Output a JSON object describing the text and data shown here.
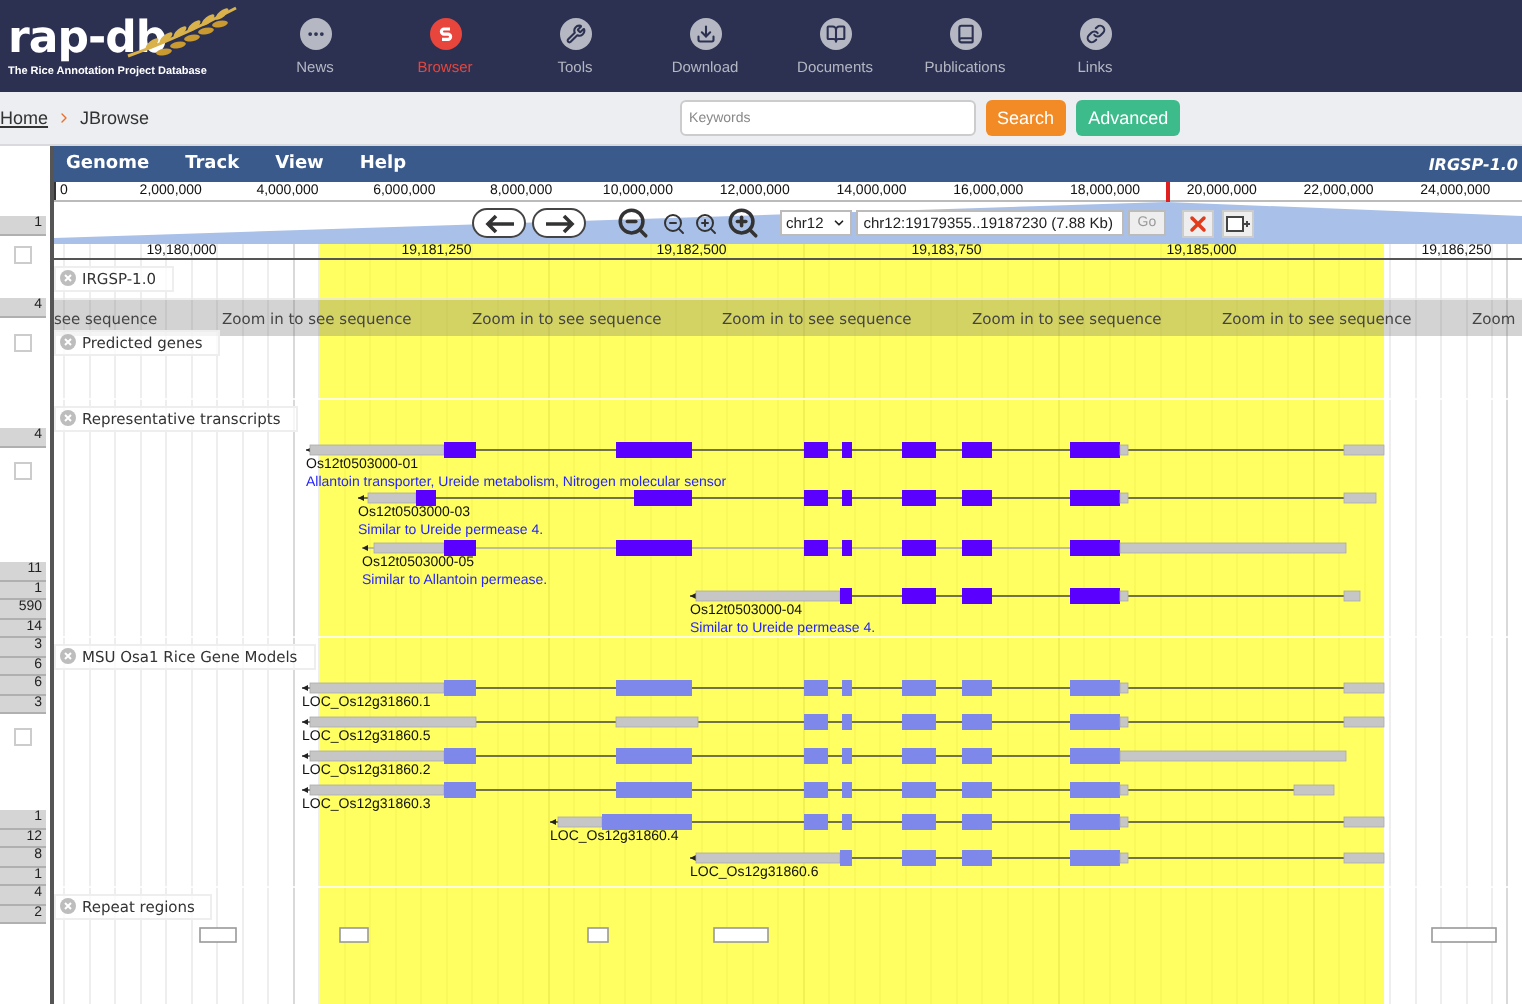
{
  "header": {
    "logo": "rap-db",
    "subtitle": "The Rice Annotation Project Database",
    "nav": [
      {
        "label": "News",
        "selected": false
      },
      {
        "label": "Browser",
        "selected": true
      },
      {
        "label": "Tools",
        "selected": false
      },
      {
        "label": "Download",
        "selected": false
      },
      {
        "label": "Documents",
        "selected": false
      },
      {
        "label": "Publications",
        "selected": false
      },
      {
        "label": "Links",
        "selected": false
      }
    ]
  },
  "breadcrumb": [
    "Home",
    "JBrowse"
  ],
  "search": {
    "placeholder": "Keywords",
    "buttons": [
      "Search",
      "Advanced"
    ]
  },
  "menu": [
    "Genome",
    "Track",
    "View",
    "Help"
  ],
  "assembly": "IRGSP-1.0",
  "overview_ruler": [
    "0",
    "2,000,000",
    "4,000,000",
    "6,000,000",
    "8,000,000",
    "10,000,000",
    "12,000,000",
    "14,000,000",
    "16,000,000",
    "18,000,000",
    "20,000,000",
    "22,000,000",
    "24,000,000"
  ],
  "navigation": {
    "chromosome": "chr12",
    "location": "chr12:19179355..19187230 (7.88 Kb)",
    "go": "Go"
  },
  "detail_ruler": [
    "19,180,000",
    "19,181,250",
    "19,182,500",
    "19,183,750",
    "19,185,000",
    "19,186,250"
  ],
  "gutter": [
    {
      "kind": "count",
      "text": "1"
    },
    {
      "kind": "checkbox",
      "checked": false
    },
    {
      "kind": "count",
      "text": "4"
    },
    {
      "kind": "checkbox",
      "checked": false
    },
    {
      "kind": "count",
      "text": "4"
    },
    {
      "kind": "checkbox",
      "checked": false
    },
    {
      "kind": "count",
      "text": "11"
    },
    {
      "kind": "count",
      "text": "1"
    },
    {
      "kind": "count",
      "text": "590"
    },
    {
      "kind": "count",
      "text": "14"
    },
    {
      "kind": "count",
      "text": "3"
    },
    {
      "kind": "count",
      "text": "6"
    },
    {
      "kind": "count",
      "text": "6"
    },
    {
      "kind": "count",
      "text": "3"
    },
    {
      "kind": "checkbox",
      "checked": false
    },
    {
      "kind": "count",
      "text": "1"
    },
    {
      "kind": "count",
      "text": "12"
    },
    {
      "kind": "count",
      "text": "8"
    },
    {
      "kind": "count",
      "text": "1"
    },
    {
      "kind": "count",
      "text": "4"
    },
    {
      "kind": "count",
      "text": "2"
    }
  ],
  "tracks": [
    {
      "kind": "sequence",
      "label": "IRGSP-1.0",
      "messages": [
        "see sequence",
        "Zoom in to see sequence",
        "Zoom in to see sequence",
        "Zoom in to see sequence",
        "Zoom in to see sequence",
        "Zoom in to see sequence",
        "Zoom"
      ]
    },
    {
      "kind": "empty",
      "label": "Predicted genes"
    },
    {
      "kind": "transcripts",
      "label": "Representative transcripts",
      "features": [
        {
          "name": "Os12t0503000-01",
          "description": "Allantoin transporter, Ureide metabolism, Nitrogen molecular sensor"
        },
        {
          "name": "Os12t0503000-03",
          "description": "Similar to Ureide permease 4."
        },
        {
          "name": "Os12t0503000-05",
          "description": "Similar to Allantoin permease."
        },
        {
          "name": "Os12t0503000-04",
          "description": "Similar to Ureide permease 4."
        }
      ]
    },
    {
      "kind": "models",
      "label": "MSU Osa1 Rice Gene Models",
      "features": [
        {
          "name": "LOC_Os12g31860.1"
        },
        {
          "name": "LOC_Os12g31860.5"
        },
        {
          "name": "LOC_Os12g31860.2"
        },
        {
          "name": "LOC_Os12g31860.3"
        },
        {
          "name": "LOC_Os12g31860.4"
        },
        {
          "name": "LOC_Os12g31860.6"
        }
      ]
    },
    {
      "kind": "repeats",
      "label": "Repeat regions"
    }
  ]
}
